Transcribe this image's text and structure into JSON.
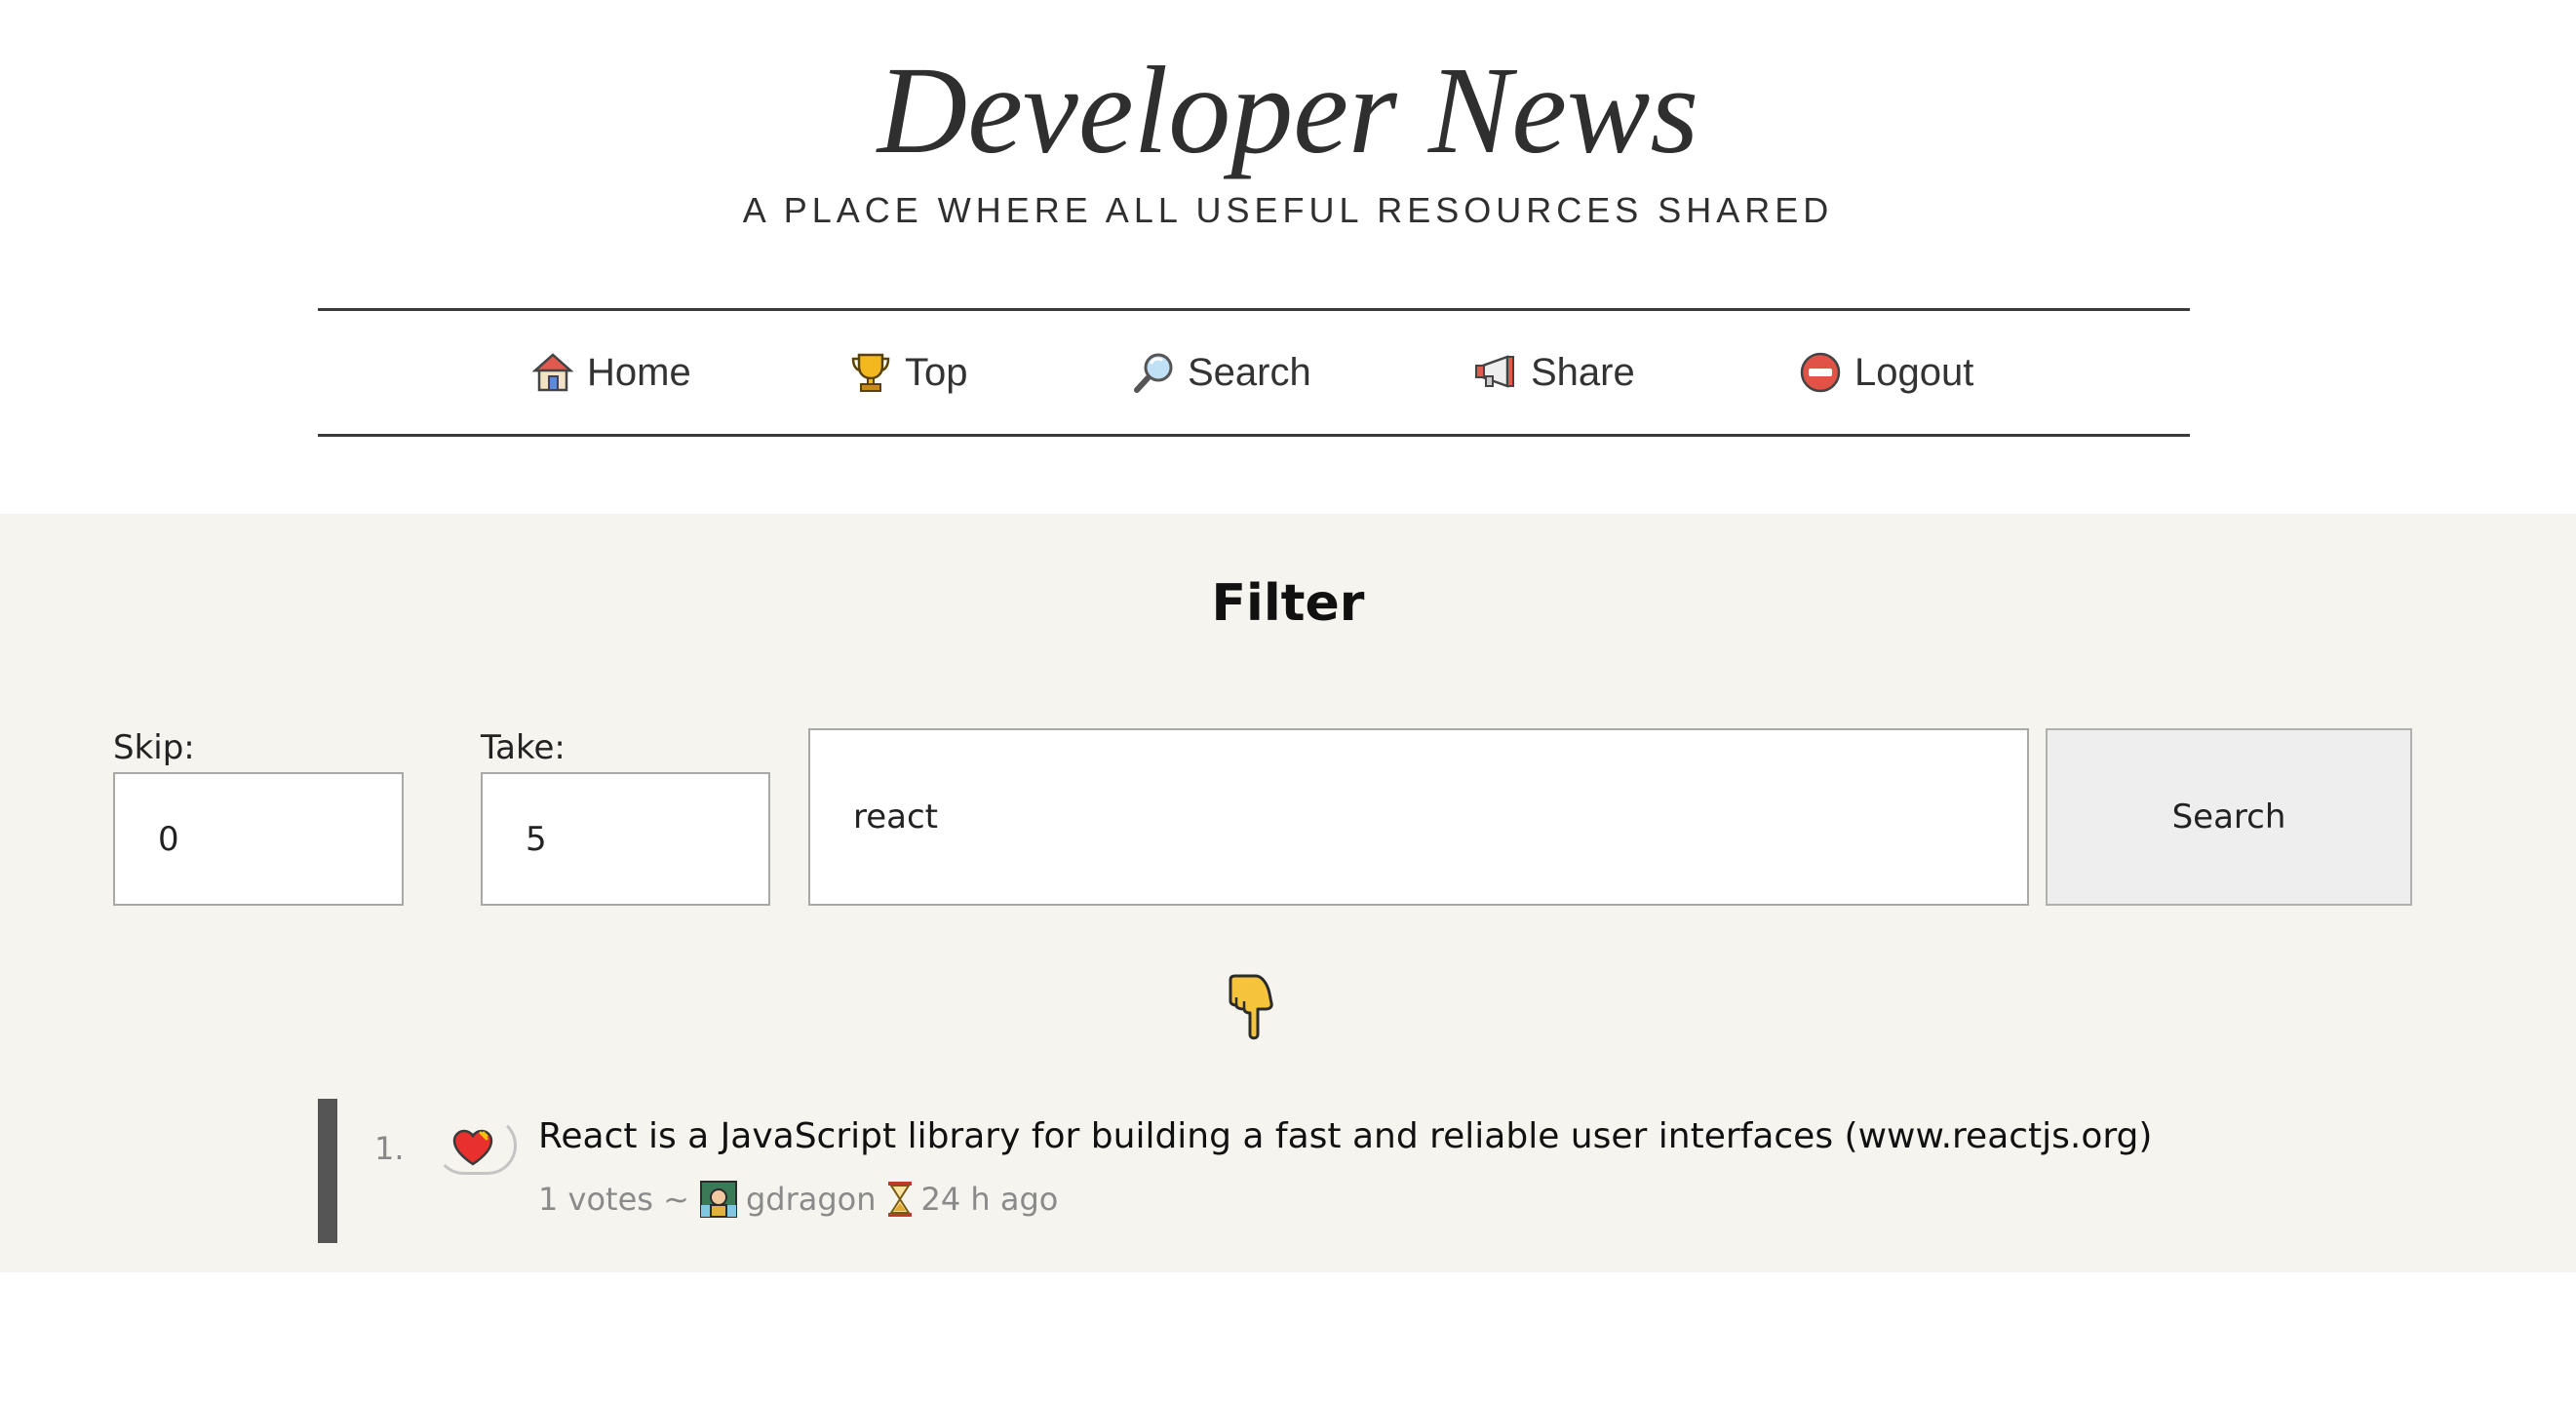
{
  "site": {
    "title": "Developer News",
    "subtitle": "A PLACE WHERE ALL USEFUL RESOURCES SHARED"
  },
  "nav": {
    "items": [
      {
        "label": "Home",
        "icon": "house-icon"
      },
      {
        "label": "Top",
        "icon": "trophy-icon"
      },
      {
        "label": "Search",
        "icon": "magnifier-icon"
      },
      {
        "label": "Share",
        "icon": "megaphone-icon"
      },
      {
        "label": "Logout",
        "icon": "no-entry-icon"
      }
    ]
  },
  "filter": {
    "title": "Filter",
    "skip_label": "Skip:",
    "skip_value": "0",
    "take_label": "Take:",
    "take_value": "5",
    "query_value": "react",
    "search_button": "Search"
  },
  "results": [
    {
      "index": "1.",
      "title": "React is a JavaScript library for building a fast and reliable user interfaces (www.reactjs.org)",
      "votes": "1 votes ~",
      "author": "gdragon",
      "age": "24 h ago",
      "vote_icon": "heart-icon",
      "author_icon": "avatar-icon",
      "age_icon": "hourglass-icon"
    }
  ],
  "colors": {
    "content_background": "#f5f4ee",
    "result_bar": "#555555",
    "meta_text": "#8a8a8a"
  }
}
